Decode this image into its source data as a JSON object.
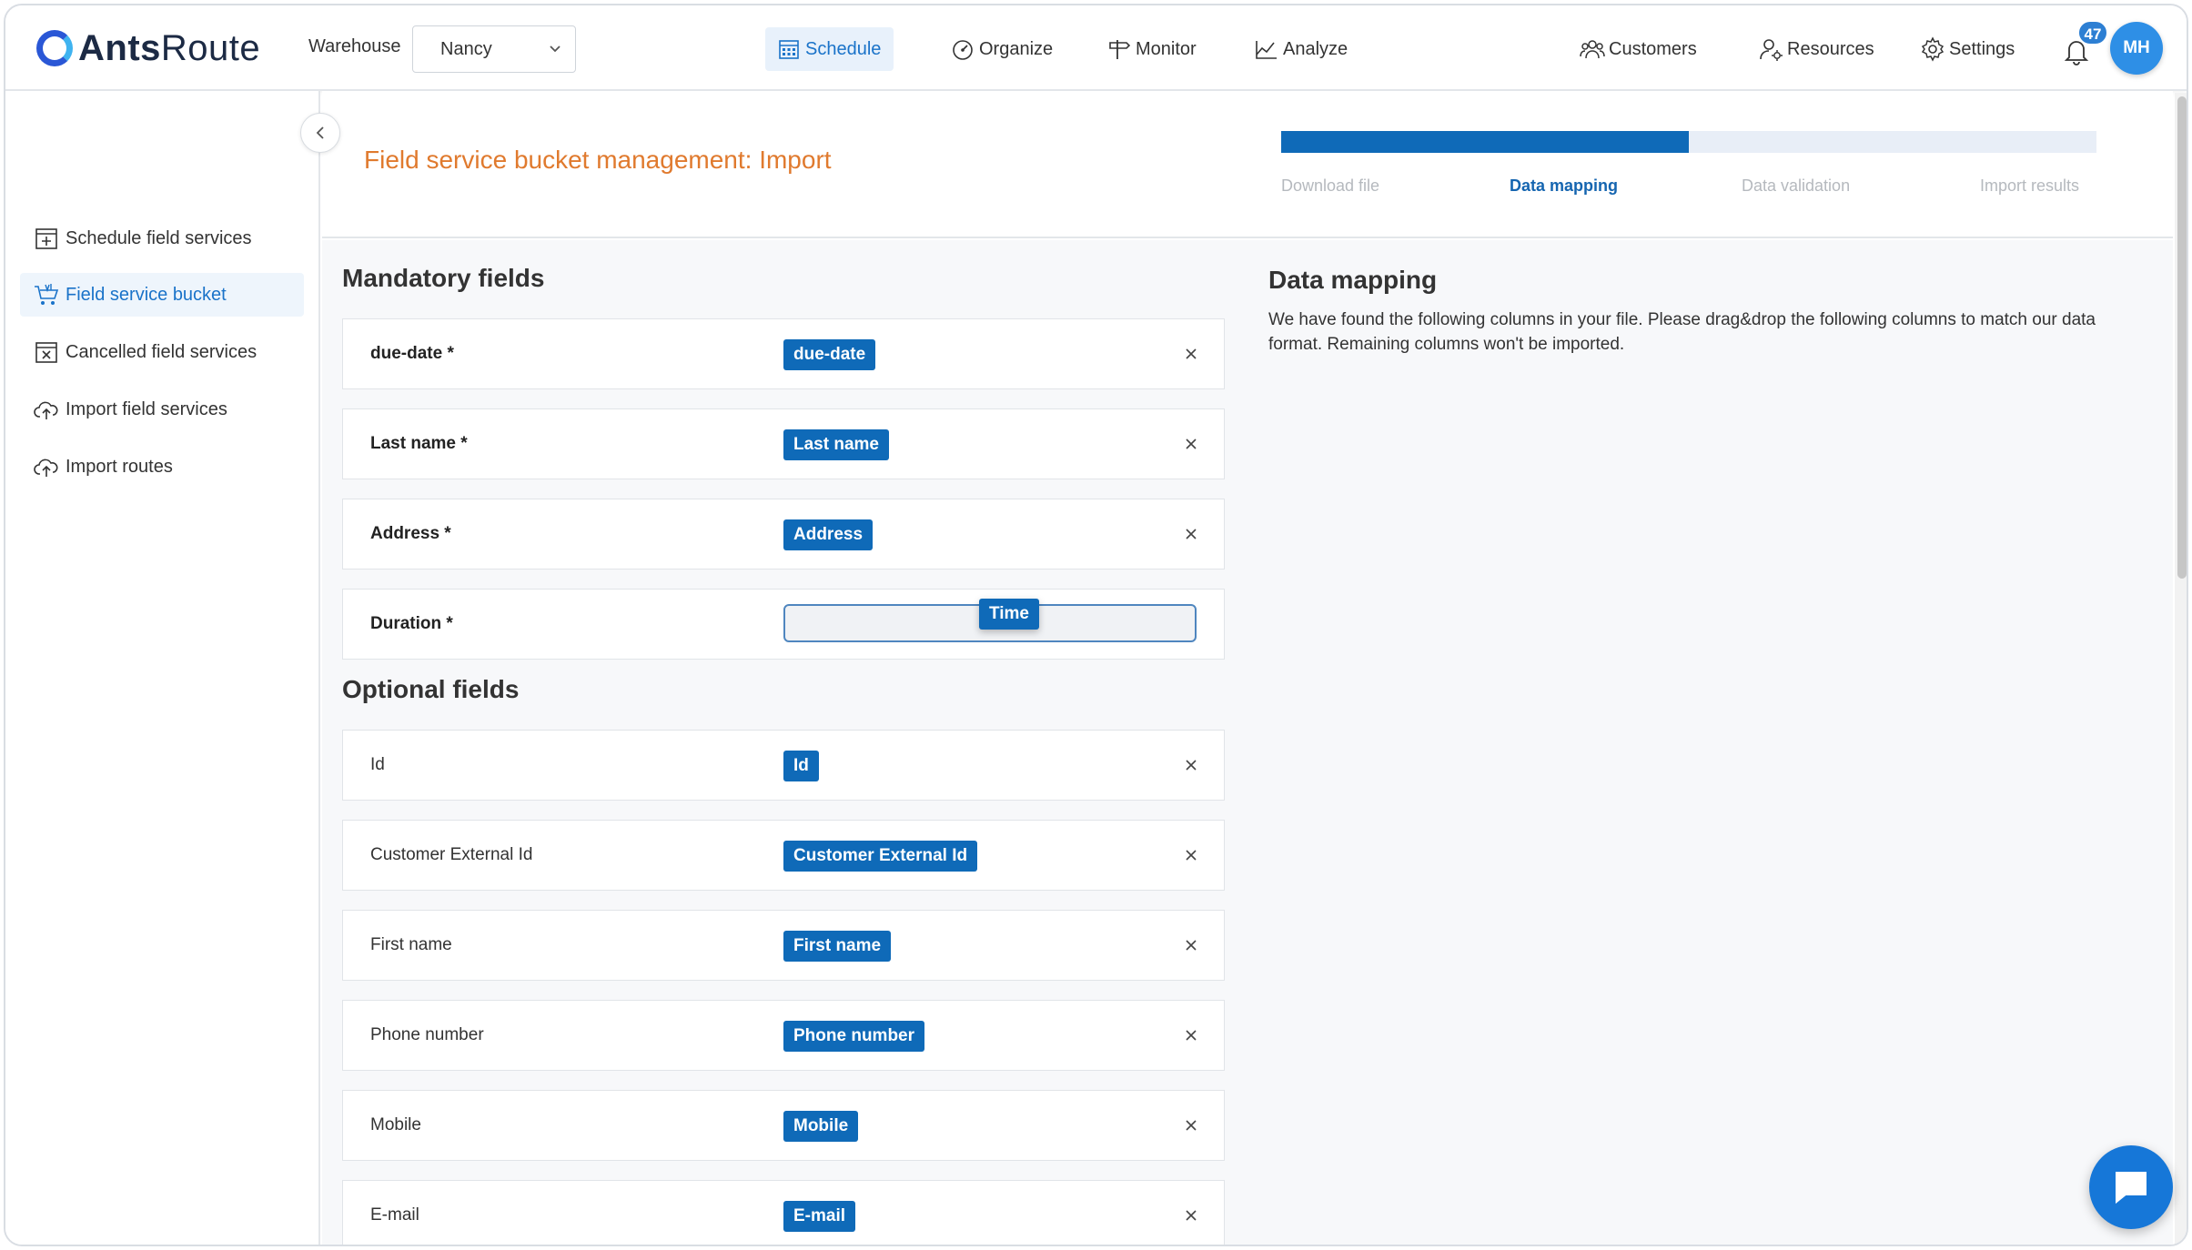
{
  "app": {
    "logo_bold": "Ants",
    "logo_regular": "Route"
  },
  "header": {
    "warehouse_label": "Warehouse",
    "warehouse_value": "Nancy",
    "nav": [
      {
        "label": "Schedule",
        "icon": "calendar-icon",
        "active": true
      },
      {
        "label": "Organize",
        "icon": "gauge-icon"
      },
      {
        "label": "Monitor",
        "icon": "signpost-icon"
      },
      {
        "label": "Analyze",
        "icon": "chart-icon"
      }
    ],
    "right_nav": [
      {
        "label": "Customers",
        "icon": "customers-icon"
      },
      {
        "label": "Resources",
        "icon": "resources-icon"
      },
      {
        "label": "Settings",
        "icon": "gear-icon"
      }
    ],
    "notifications_count": "47",
    "avatar_initials": "MH"
  },
  "sidebar": {
    "items": [
      {
        "label": "Schedule field services",
        "icon": "calendar-plus-icon"
      },
      {
        "label": "Field service bucket",
        "icon": "cart-icon",
        "active": true
      },
      {
        "label": "Cancelled field services",
        "icon": "calendar-x-icon"
      },
      {
        "label": "Import field services",
        "icon": "cloud-upload-icon"
      },
      {
        "label": "Import routes",
        "icon": "cloud-upload-icon"
      }
    ]
  },
  "page": {
    "title": "Field service bucket management: Import",
    "progress_fraction": 0.5,
    "steps": [
      "Download file",
      "Data mapping",
      "Data validation",
      "Import results"
    ],
    "active_step": 1
  },
  "mandatory": {
    "title": "Mandatory fields",
    "fields": [
      {
        "label": "due-date *",
        "chip": "due-date"
      },
      {
        "label": "Last name *",
        "chip": "Last name"
      },
      {
        "label": "Address *",
        "chip": "Address"
      },
      {
        "label": "Duration *",
        "chip": ""
      }
    ],
    "dragging_chip": "Time"
  },
  "optional": {
    "title": "Optional fields",
    "fields": [
      {
        "label": "Id",
        "chip": "Id"
      },
      {
        "label": "Customer External Id",
        "chip": "Customer External Id"
      },
      {
        "label": "First name",
        "chip": "First name"
      },
      {
        "label": "Phone number",
        "chip": "Phone number"
      },
      {
        "label": "Mobile",
        "chip": "Mobile"
      },
      {
        "label": "E-mail",
        "chip": "E-mail"
      }
    ]
  },
  "data_mapping": {
    "title": "Data mapping",
    "description": "We have found the following columns in your file. Please drag&drop the following columns to match our data format. Remaining columns won't be imported."
  },
  "colors": {
    "accent": "#0f6ab8",
    "title_orange": "#e07a2e",
    "active_nav_bg": "#e8f1fb"
  }
}
